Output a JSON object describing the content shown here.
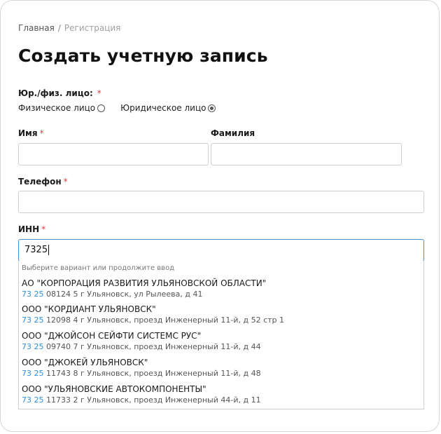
{
  "breadcrumb": {
    "home": "Главная",
    "separator": "/",
    "current": "Регистрация"
  },
  "title": "Создать учетную запись",
  "entity_type": {
    "label": "Юр./физ. лицо:",
    "required_mark": "*",
    "options": [
      {
        "label": "Физическое лицо",
        "checked": false
      },
      {
        "label": "Юридическое лицо",
        "checked": true
      }
    ]
  },
  "first_name": {
    "label": "Имя",
    "required_mark": "*",
    "value": ""
  },
  "last_name": {
    "label": "Фамилия",
    "value": ""
  },
  "phone": {
    "label": "Телефон",
    "required_mark": "*",
    "value": ""
  },
  "inn": {
    "label": "ИНН",
    "required_mark": "*",
    "value": "7325"
  },
  "suggestions": {
    "hint": "Выберите вариант или продолжите ввод",
    "items": [
      {
        "name": "АО \"КОРПОРАЦИЯ РАЗВИТИЯ УЛЬЯНОВСКОЙ ОБЛАСТИ\"",
        "inn_a": "73",
        "inn_b": "25",
        "inn_rest": "08124 5",
        "address": "г Ульяновск, ул Рылеева, д 41"
      },
      {
        "name": "ООО \"КОРДИАНТ УЛЬЯНОВСК\"",
        "inn_a": "73",
        "inn_b": "25",
        "inn_rest": "12098 4",
        "address": "г Ульяновск, проезд Инженерный 11-й, д 52 стр 1"
      },
      {
        "name": "ООО \"ДЖОЙСОН СЕЙФТИ СИСТЕМС РУС\"",
        "inn_a": "73",
        "inn_b": "25",
        "inn_rest": "09740 7",
        "address": "г Ульяновск, проезд Инженерный 11-й, д 44"
      },
      {
        "name": "ООО \"ДЖОКЕЙ УЛЬЯНОВСК\"",
        "inn_a": "73",
        "inn_b": "25",
        "inn_rest": "11743 8",
        "address": "г Ульяновск, проезд Инженерный 11-й, д 48"
      },
      {
        "name": "ООО \"УЛЬЯНОВСКИЕ АВТОКОМПОНЕНТЫ\"",
        "inn_a": "73",
        "inn_b": "25",
        "inn_rest": "11733 2",
        "address": "г Ульяновск, проезд Инженерный 44-й, д 11"
      }
    ]
  }
}
